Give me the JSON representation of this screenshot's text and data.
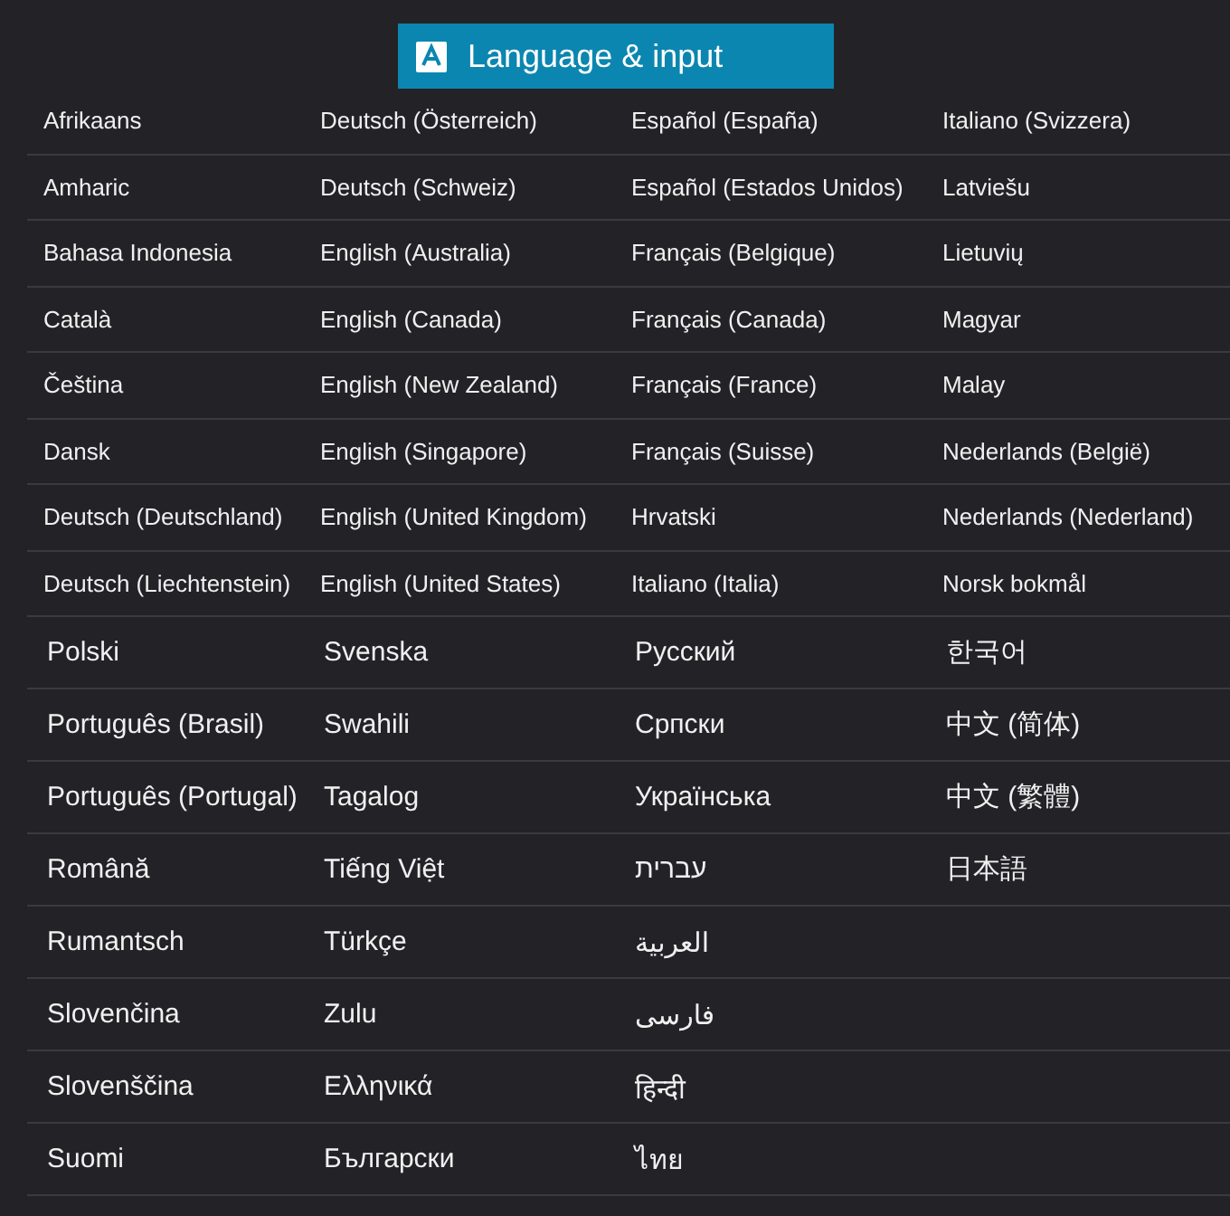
{
  "header": {
    "title": "Language & input"
  },
  "sections": [
    {
      "kind": "compact",
      "rows": [
        [
          "Afrikaans",
          "Deutsch (Österreich)",
          "Español (España)",
          "Italiano (Svizzera)"
        ],
        [
          "Amharic",
          "Deutsch (Schweiz)",
          "Español (Estados Unidos)",
          "Latviešu"
        ],
        [
          "Bahasa Indonesia",
          "English (Australia)",
          "Français (Belgique)",
          "Lietuvių"
        ],
        [
          "Català",
          "English (Canada)",
          "Français (Canada)",
          "Magyar"
        ],
        [
          "Čeština",
          "English (New Zealand)",
          "Français (France)",
          "Malay"
        ],
        [
          "Dansk",
          "English (Singapore)",
          "Français (Suisse)",
          "Nederlands (België)"
        ],
        [
          "Deutsch (Deutschland)",
          "English (United Kingdom)",
          "Hrvatski",
          "Nederlands (Nederland)"
        ],
        [
          "Deutsch (Liechtenstein)",
          "English (United States)",
          "Italiano (Italia)",
          "Norsk bokmål"
        ]
      ]
    },
    {
      "kind": "large",
      "rows": [
        [
          "Polski",
          "Svenska",
          "Русский",
          "한국어"
        ],
        [
          "Português (Brasil)",
          "Swahili",
          "Српски",
          "中文 (简体)"
        ],
        [
          "Português (Portugal)",
          "Tagalog",
          "Українська",
          "中文 (繁體)"
        ],
        [
          "Română",
          "Tiếng Việt",
          "עברית",
          "日本語"
        ],
        [
          "Rumantsch",
          "Türkçe",
          "العربية"
        ],
        [
          "Slovenčina",
          "Zulu",
          "فارسی"
        ],
        [
          "Slovenščina",
          "Ελληνικά",
          "हिन्दी"
        ],
        [
          "Suomi",
          "Български",
          "ไทย"
        ]
      ]
    }
  ]
}
